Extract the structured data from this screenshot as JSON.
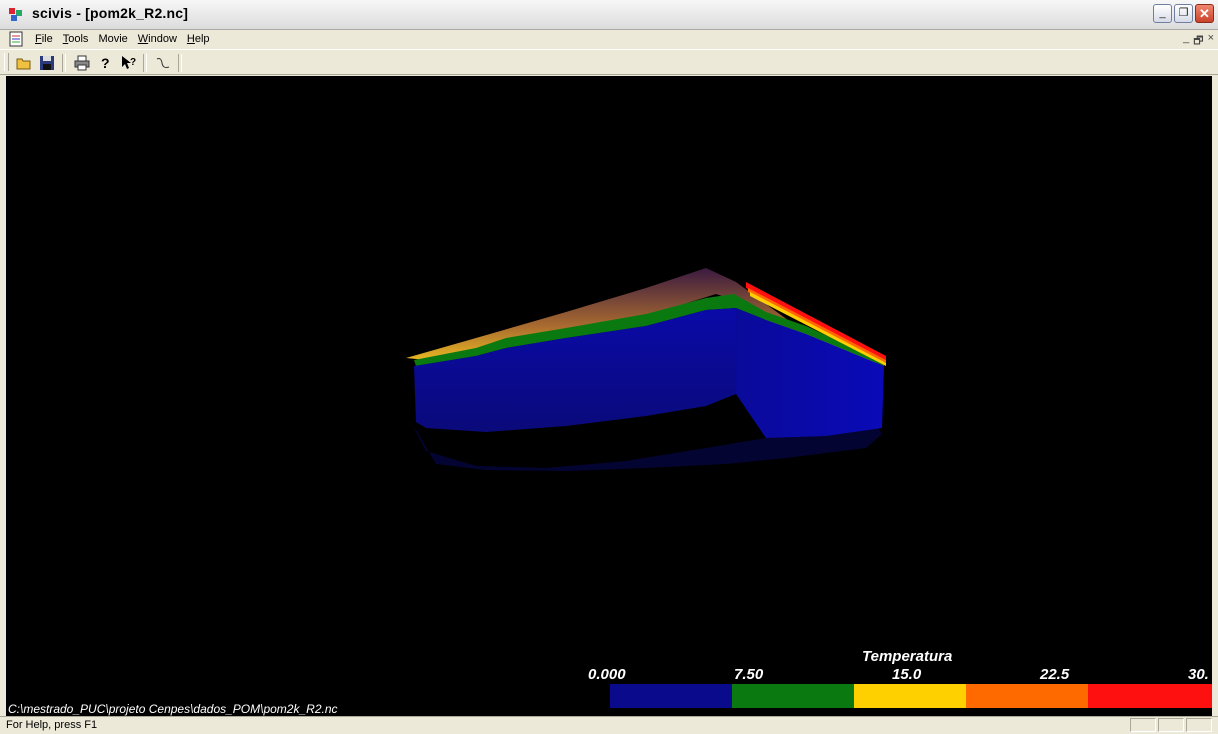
{
  "window": {
    "title": "scivis - [pom2k_R2.nc]",
    "buttons": {
      "minimize": "_",
      "restore": "❐",
      "close": "✕"
    }
  },
  "menu": {
    "items": [
      {
        "label": "File",
        "accel": "F",
        "rest": "ile"
      },
      {
        "label": "Tools",
        "accel": "T",
        "rest": "ools"
      },
      {
        "label": "Movie",
        "accel": "",
        "rest": "Movie"
      },
      {
        "label": "Window",
        "accel": "W",
        "rest": "indow"
      },
      {
        "label": "Help",
        "accel": "H",
        "rest": "elp"
      }
    ],
    "mdi": {
      "minimize": "_",
      "restore": "🗗",
      "close": "×"
    }
  },
  "toolbar": {
    "icons": [
      "open-folder-icon",
      "save-disk-icon",
      "print-icon",
      "help-icon",
      "context-help-icon",
      "curve-icon"
    ]
  },
  "legend": {
    "title": "Temperatura",
    "labels": [
      "0.000",
      "7.50",
      "15.0",
      "22.5",
      "30."
    ],
    "colors": [
      "#0a0a8c",
      "#0a7a10",
      "#ffd000",
      "#ff6a00",
      "#ff1010"
    ]
  },
  "viewport": {
    "file_path": "C:\\mestrado_PUC\\projeto Cenpes\\dados_POM\\pom2k_R2.nc"
  },
  "status": {
    "text": "For Help, press F1"
  }
}
